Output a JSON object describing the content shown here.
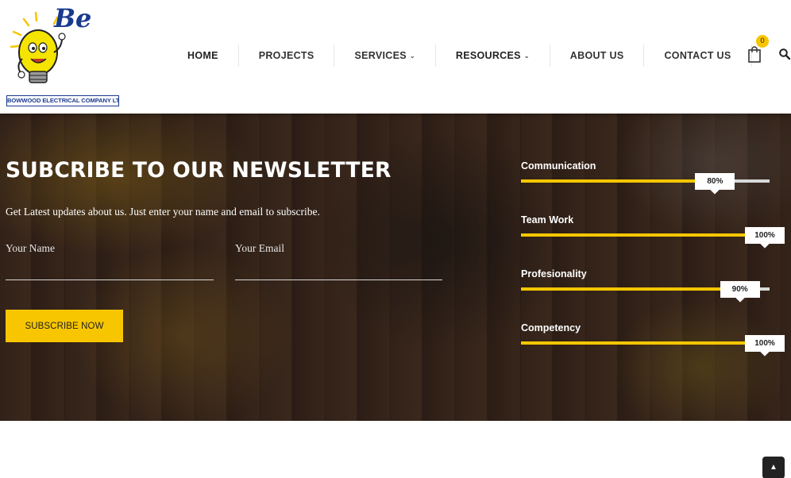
{
  "brand": {
    "logo_letters": "Be",
    "company_name": "BOWWOOD ELECTRICAL COMPANY LTD."
  },
  "nav": {
    "items": [
      {
        "label": "HOME",
        "has_dropdown": false
      },
      {
        "label": "PROJECTS",
        "has_dropdown": false
      },
      {
        "label": "SERVICES",
        "has_dropdown": true
      },
      {
        "label": "RESOURCES",
        "has_dropdown": true
      },
      {
        "label": "ABOUT US",
        "has_dropdown": false
      },
      {
        "label": "CONTACT US",
        "has_dropdown": false
      }
    ],
    "cart_count": "0",
    "cart_icon": "shopping-bag-icon",
    "search_icon": "search-icon"
  },
  "newsletter": {
    "title": "SUBCRIBE TO OUR NEWSLETTER",
    "subtitle": "Get Latest updates about us. Just enter your name and email to subscribe.",
    "name_placeholder": "Your Name",
    "email_placeholder": "Your Email",
    "button_label": "SUBSCRIBE NOW"
  },
  "skills": [
    {
      "label": "Communication",
      "percent": 80,
      "percent_label": "80%"
    },
    {
      "label": "Team Work",
      "percent": 100,
      "percent_label": "100%"
    },
    {
      "label": "Profesionality",
      "percent": 90,
      "percent_label": "90%"
    },
    {
      "label": "Competency",
      "percent": 100,
      "percent_label": "100%"
    }
  ],
  "colors": {
    "accent": "#f7c600",
    "track": "#d9d9d9",
    "logo_blue": "#1a3a8f"
  },
  "back_to_top_icon": "chevron-up-icon"
}
